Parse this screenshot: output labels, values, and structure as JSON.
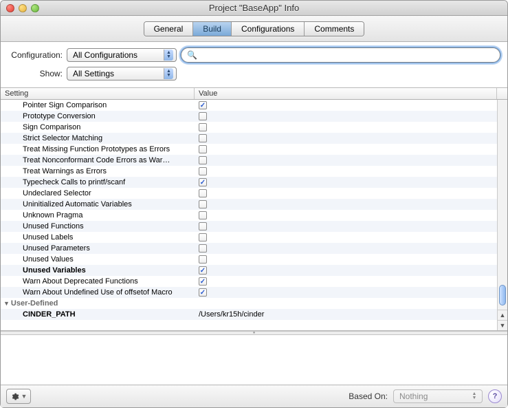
{
  "window": {
    "title": "Project \"BaseApp\" Info"
  },
  "tabs": [
    "General",
    "Build",
    "Configurations",
    "Comments"
  ],
  "active_tab": 1,
  "filters": {
    "config_label": "Configuration:",
    "config_value": "All Configurations",
    "show_label": "Show:",
    "show_value": "All Settings",
    "search_placeholder": ""
  },
  "columns": {
    "setting": "Setting",
    "value": "Value"
  },
  "rows": [
    {
      "label": "Pointer Sign Comparison",
      "checked": true
    },
    {
      "label": "Prototype Conversion",
      "checked": false
    },
    {
      "label": "Sign Comparison",
      "checked": false
    },
    {
      "label": "Strict Selector Matching",
      "checked": false
    },
    {
      "label": "Treat Missing Function Prototypes as Errors",
      "checked": false
    },
    {
      "label": "Treat Nonconformant Code Errors as War…",
      "checked": false
    },
    {
      "label": "Treat Warnings as Errors",
      "checked": false
    },
    {
      "label": "Typecheck Calls to printf/scanf",
      "checked": true
    },
    {
      "label": "Undeclared Selector",
      "checked": false
    },
    {
      "label": "Uninitialized Automatic Variables",
      "checked": false
    },
    {
      "label": "Unknown Pragma",
      "checked": false
    },
    {
      "label": "Unused Functions",
      "checked": false
    },
    {
      "label": "Unused Labels",
      "checked": false
    },
    {
      "label": "Unused Parameters",
      "checked": false
    },
    {
      "label": "Unused Values",
      "checked": false
    },
    {
      "label": "Unused Variables",
      "checked": true,
      "bold": true
    },
    {
      "label": "Warn About Deprecated Functions",
      "checked": true
    },
    {
      "label": "Warn About Undefined Use of offsetof Macro",
      "checked": true
    }
  ],
  "group": {
    "label": "User-Defined"
  },
  "user_defined": {
    "key": "CINDER_PATH",
    "value": "/Users/kr15h/cinder"
  },
  "footer": {
    "based_on_label": "Based On:",
    "based_on_value": "Nothing"
  }
}
